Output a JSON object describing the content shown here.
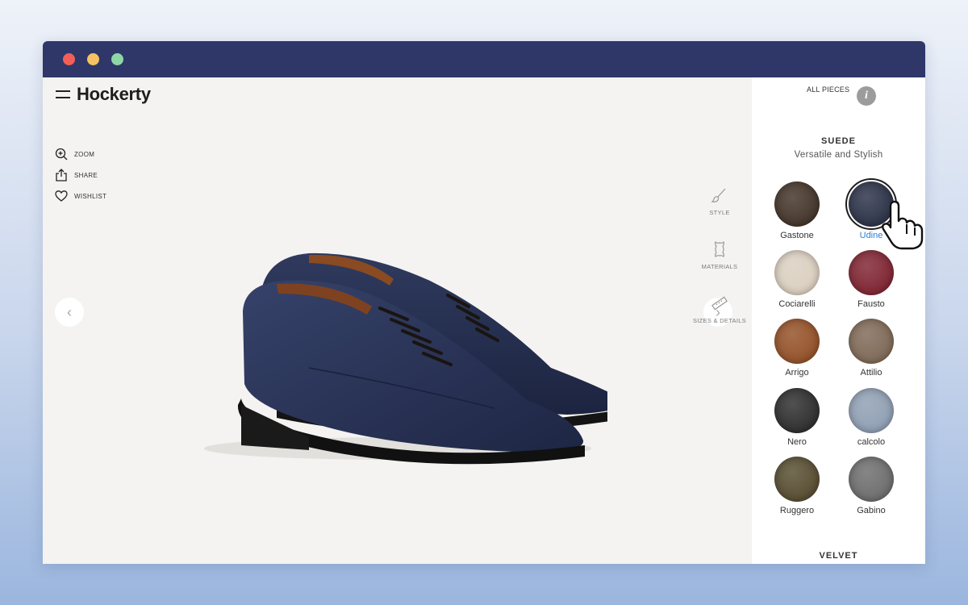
{
  "window": {
    "controls": [
      {
        "name": "close",
        "color": "#f25f58"
      },
      {
        "name": "minimize",
        "color": "#f5c264"
      },
      {
        "name": "maximize",
        "color": "#8fd6a6"
      }
    ]
  },
  "brand": {
    "logo": "Hockerty",
    "menu_icon": "hamburger-icon"
  },
  "tools": [
    {
      "id": "zoom",
      "icon": "zoom-in-icon",
      "label": "ZOOM"
    },
    {
      "id": "share",
      "icon": "share-icon",
      "label": "SHARE"
    },
    {
      "id": "wishlist",
      "icon": "heart-icon",
      "label": "WISHLIST"
    }
  ],
  "carousel": {
    "prev_icon": "chevron-left-icon",
    "next_icon": "chevron-right-icon",
    "prev_glyph": "‹",
    "next_glyph": "›"
  },
  "side_nav": [
    {
      "id": "style",
      "icon": "brush-icon",
      "label": "STYLE"
    },
    {
      "id": "materials",
      "icon": "leather-hide-icon",
      "label": "MATERIALS"
    },
    {
      "id": "sizes",
      "icon": "ruler-icon",
      "label": "SIZES & DETAILS"
    }
  ],
  "panel": {
    "all_pieces": "ALL PIECES",
    "info_glyph": "i",
    "sections": [
      {
        "title": "SUEDE",
        "subtitle": "Versatile and Stylish",
        "swatches": [
          {
            "name": "Gastone",
            "color": "#3b2c20",
            "selected": false
          },
          {
            "name": "Udine",
            "color": "#232a40",
            "selected": true
          },
          {
            "name": "Cociarelli",
            "color": "#d9cdbd",
            "selected": false
          },
          {
            "name": "Fausto",
            "color": "#7a1c2a",
            "selected": false
          },
          {
            "name": "Arrigo",
            "color": "#8f4a1f",
            "selected": false
          },
          {
            "name": "Attilio",
            "color": "#7a6350",
            "selected": false
          },
          {
            "name": "Nero",
            "color": "#252525",
            "selected": false
          },
          {
            "name": "calcolo",
            "color": "#8b9bb0",
            "selected": false
          },
          {
            "name": "Ruggero",
            "color": "#504528",
            "selected": false
          },
          {
            "name": "Gabino",
            "color": "#676767",
            "selected": false
          }
        ]
      },
      {
        "title": "VELVET",
        "subtitle": "",
        "swatches": []
      }
    ]
  },
  "colors": {
    "titlebar": "#2e3768",
    "accent": "#2b7fd4",
    "stage": "#f4f3f1",
    "shoe": "#262f4e"
  }
}
